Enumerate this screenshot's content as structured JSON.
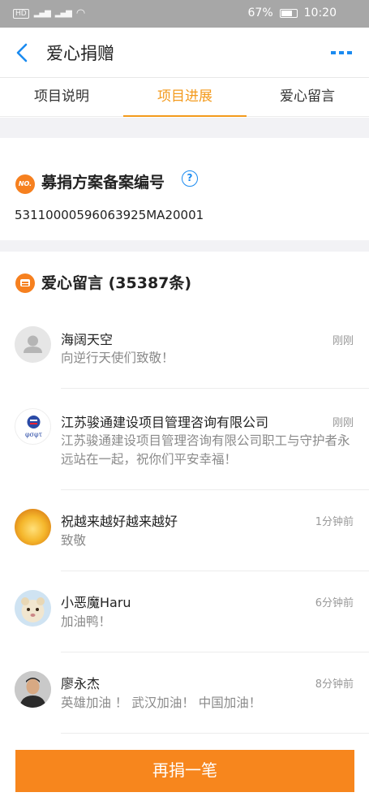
{
  "status": {
    "left_text": "HD 4G",
    "battery": "67%",
    "time": "10:20"
  },
  "nav": {
    "title": "爱心捐赠",
    "back_icon": "chevron-left-icon",
    "more_icon": "more-dots-icon",
    "accent": "#1b8bf0"
  },
  "tabs": [
    {
      "label": "项目说明",
      "active": false
    },
    {
      "label": "项目进展",
      "active": true
    },
    {
      "label": "爱心留言",
      "active": false
    }
  ],
  "record": {
    "badge": "NO.",
    "heading": "募捐方案备案编号",
    "help": "?",
    "number": "53110000596063925MA20001"
  },
  "comments": {
    "heading": "爱心留言 (35387条)",
    "items": [
      {
        "name": "海阔天空",
        "time": "刚刚",
        "text": "向逆行天使们致敬！",
        "avatar": "default-avatar"
      },
      {
        "name": "江苏骏通建设项目管理咨询有限公司",
        "time": "刚刚",
        "text": "江苏骏通建设项目管理咨询有限公司职工与守护者永远站在一起，祝你们平安幸福！",
        "avatar": "company-logo",
        "logo_text": "φσφτ"
      },
      {
        "name": "祝越来越好越来越好",
        "time": "1分钟前",
        "text": "致敬",
        "avatar": "flower-photo"
      },
      {
        "name": "小恶魔Haru",
        "time": "6分钟前",
        "text": "加油鸭！",
        "avatar": "cartoon-photo"
      },
      {
        "name": "廖永杰",
        "time": "8分钟前",
        "text": "英雄加油 ！ 武汉加油！ 中国加油！",
        "avatar": "person-photo"
      }
    ]
  },
  "footer": {
    "donate_label": "再捐一笔",
    "accent": "#f7861d"
  }
}
